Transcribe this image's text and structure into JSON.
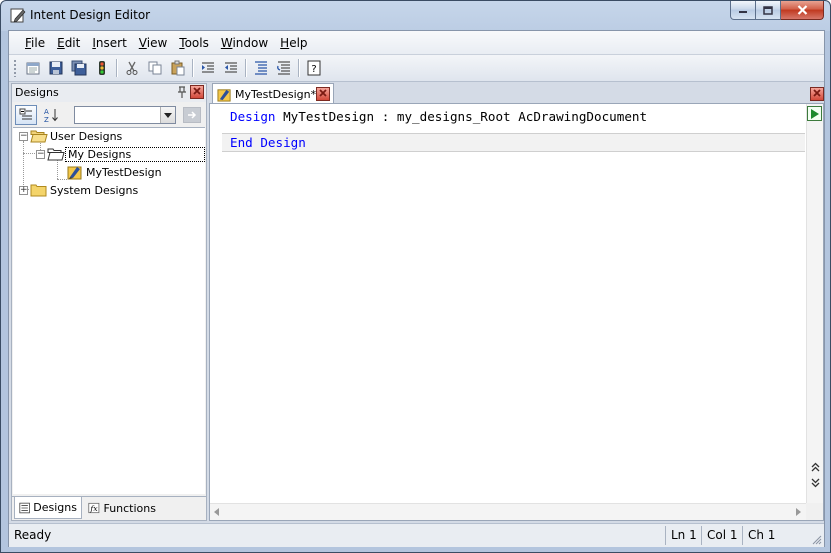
{
  "window": {
    "title": "Intent Design Editor",
    "icons": [
      "app-icon",
      "minimize-icon",
      "maximize-icon",
      "close-icon"
    ]
  },
  "menu": {
    "items": [
      {
        "label": "File",
        "key": "F",
        "rest": "ile"
      },
      {
        "label": "Edit",
        "key": "E",
        "rest": "dit"
      },
      {
        "label": "Insert",
        "key": "I",
        "rest": "nsert"
      },
      {
        "label": "View",
        "key": "V",
        "rest": "iew"
      },
      {
        "label": "Tools",
        "key": "T",
        "rest": "ools"
      },
      {
        "label": "Window",
        "key": "W",
        "rest": "indow"
      },
      {
        "label": "Help",
        "key": "H",
        "rest": "elp"
      }
    ]
  },
  "toolbar": {
    "buttons": [
      "new-design-icon",
      "save-icon",
      "save-all-icon",
      "build-icon",
      "cut-icon",
      "copy-icon",
      "paste-icon",
      "indent-icon",
      "outdent-icon",
      "comment-icon",
      "uncomment-icon",
      "help-icon"
    ]
  },
  "designs_pane": {
    "title": "Designs",
    "search": {
      "value": ""
    },
    "tree": {
      "user_designs": "User Designs",
      "my_designs": "My Designs",
      "my_test_design": "MyTestDesign",
      "system_designs": "System Designs",
      "expanders": {
        "user_designs": "−",
        "my_designs": "−",
        "system_designs": "+"
      }
    },
    "tabs": {
      "designs": "Designs",
      "functions": "Functions"
    },
    "colors": {
      "folder": "#f4d46a",
      "folder_edge": "#b08a1e"
    }
  },
  "editor": {
    "tab_label": "MyTestDesign*",
    "code": {
      "line1": {
        "kw": "Design",
        "name": "MyTestDesign",
        "colon": ":",
        "mixins": "my_designs_Root AcDrawingDocument"
      },
      "line2": {
        "kw1": "End",
        "kw2": "Design"
      }
    },
    "colors": {
      "keyword": "#0000ff",
      "text": "#000000"
    }
  },
  "status": {
    "text": "Ready",
    "ln": "Ln 1",
    "col": "Col 1",
    "ch": "Ch 1"
  }
}
